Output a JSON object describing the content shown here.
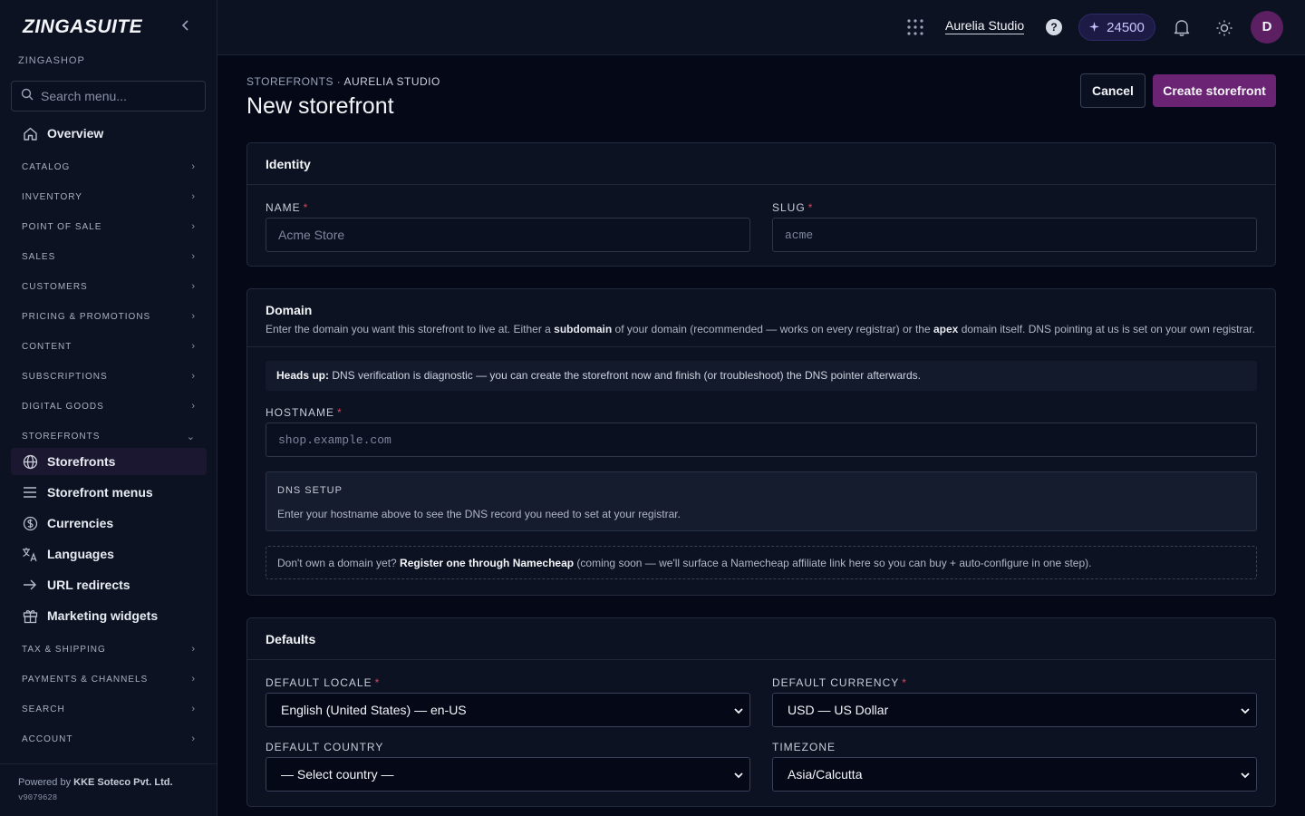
{
  "sidebar": {
    "brand": "ZINGASUITE",
    "org_label": "ZINGASHOP",
    "search_placeholder": "Search menu...",
    "overview": "Overview",
    "sections": [
      "CATALOG",
      "INVENTORY",
      "POINT OF SALE",
      "SALES",
      "CUSTOMERS",
      "PRICING & PROMOTIONS",
      "CONTENT",
      "SUBSCRIPTIONS",
      "DIGITAL GOODS",
      "STOREFRONTS"
    ],
    "storefront_items": [
      "Storefronts",
      "Storefront menus",
      "Currencies",
      "Languages",
      "URL redirects",
      "Marketing widgets"
    ],
    "sections_after": [
      "TAX & SHIPPING",
      "PAYMENTS & CHANNELS",
      "SEARCH",
      "ACCOUNT"
    ],
    "powered_prefix": "Powered by",
    "powered_by": "KKE Soteco Pvt. Ltd.",
    "version": "v9079628"
  },
  "topbar": {
    "org_name": "Aurelia Studio",
    "credits": "24500",
    "avatar_initial": "D"
  },
  "page": {
    "breadcrumb_parent": "STOREFRONTS",
    "breadcrumb_sep": " · ",
    "breadcrumb_current": "AURELIA STUDIO",
    "title": "New storefront",
    "cancel_label": "Cancel",
    "create_label": "Create storefront"
  },
  "identity": {
    "title": "Identity",
    "name_label": "NAME",
    "name_placeholder": "Acme Store",
    "slug_label": "SLUG",
    "slug_placeholder": "acme"
  },
  "domain": {
    "title": "Domain",
    "desc_1": "Enter the domain you want this storefront to live at. Either a ",
    "desc_b1": "subdomain",
    "desc_2": " of your domain (recommended — works on every registrar) or the ",
    "desc_b2": "apex",
    "desc_3": " domain itself. DNS pointing at us is set on your own registrar.",
    "notice_bold": "Heads up:",
    "notice_text": " DNS verification is diagnostic — you can create the storefront now and finish (or troubleshoot) the DNS pointer afterwards.",
    "hostname_label": "HOSTNAME",
    "hostname_placeholder": "shop.example.com",
    "dns_heading": "DNS SETUP",
    "dns_text": "Enter your hostname above to see the DNS record you need to set at your registrar.",
    "nc_prefix": "Don't own a domain yet? ",
    "nc_bold": "Register one through Namecheap",
    "nc_suffix": " (coming soon — we'll surface a Namecheap affiliate link here so you can buy + auto-configure in one step)."
  },
  "defaults": {
    "title": "Defaults",
    "locale_label": "DEFAULT LOCALE",
    "locale_value": "English (United States) — en-US",
    "currency_label": "DEFAULT CURRENCY",
    "currency_value": "USD — US Dollar",
    "country_label": "DEFAULT COUNTRY",
    "country_value": "— Select country —",
    "timezone_label": "TIMEZONE",
    "timezone_value": "Asia/Calcutta"
  },
  "colors": {
    "accent": "#6b2373",
    "required": "#d04c5c",
    "credits_bg": "#1d1a46"
  }
}
